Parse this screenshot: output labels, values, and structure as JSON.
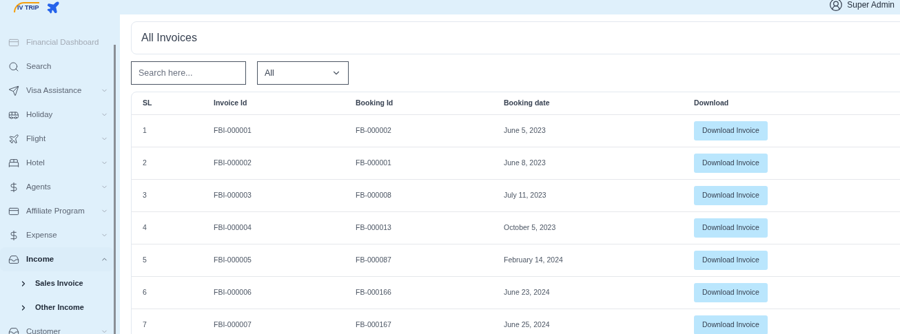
{
  "brand": {
    "logo_text": "IV TRIP"
  },
  "user": {
    "name": "Super Admin"
  },
  "sidebar": {
    "items": [
      {
        "label": "Financial Dashboard",
        "kind": "link",
        "disabled": true,
        "expanded": false
      },
      {
        "label": "Search",
        "kind": "link",
        "disabled": false,
        "expanded": false
      },
      {
        "label": "Visa Assistance",
        "kind": "menu",
        "disabled": false,
        "expanded": false
      },
      {
        "label": "Holiday",
        "kind": "menu",
        "disabled": false,
        "expanded": false
      },
      {
        "label": "Flight",
        "kind": "menu",
        "disabled": false,
        "expanded": false
      },
      {
        "label": "Hotel",
        "kind": "menu",
        "disabled": false,
        "expanded": false
      },
      {
        "label": "Agents",
        "kind": "menu",
        "disabled": false,
        "expanded": false
      },
      {
        "label": "Affiliate Program",
        "kind": "menu",
        "disabled": false,
        "expanded": false
      },
      {
        "label": "Expense",
        "kind": "menu",
        "disabled": false,
        "expanded": false
      },
      {
        "label": "Income",
        "kind": "menu",
        "disabled": false,
        "expanded": true,
        "children": [
          {
            "label": "Sales Invoice"
          },
          {
            "label": "Other Income"
          }
        ]
      },
      {
        "label": "Customer",
        "kind": "menu",
        "disabled": false,
        "expanded": false
      }
    ]
  },
  "page": {
    "title": "All Invoices"
  },
  "search": {
    "placeholder": "Search here..."
  },
  "filter": {
    "value": "All"
  },
  "table": {
    "columns": [
      "SL",
      "Invoice Id",
      "Booking Id",
      "Booking date",
      "Download"
    ],
    "rows": [
      {
        "sl": "1",
        "invoice_id": "FBI-000001",
        "booking_id": "FB-000002",
        "date": "June 5, 2023",
        "action": "Download Invoice"
      },
      {
        "sl": "2",
        "invoice_id": "FBI-000002",
        "booking_id": "FB-000001",
        "date": "June 8, 2023",
        "action": "Download Invoice"
      },
      {
        "sl": "3",
        "invoice_id": "FBI-000003",
        "booking_id": "FB-000008",
        "date": "July 11, 2023",
        "action": "Download Invoice"
      },
      {
        "sl": "4",
        "invoice_id": "FBI-000004",
        "booking_id": "FB-000013",
        "date": "October 5, 2023",
        "action": "Download Invoice"
      },
      {
        "sl": "5",
        "invoice_id": "FBI-000005",
        "booking_id": "FB-000087",
        "date": "February 14, 2024",
        "action": "Download Invoice"
      },
      {
        "sl": "6",
        "invoice_id": "FBI-000006",
        "booking_id": "FB-000166",
        "date": "June 23, 2024",
        "action": "Download Invoice"
      },
      {
        "sl": "7",
        "invoice_id": "FBI-000007",
        "booking_id": "FB-000167",
        "date": "June 25, 2024",
        "action": "Download Invoice"
      }
    ]
  }
}
